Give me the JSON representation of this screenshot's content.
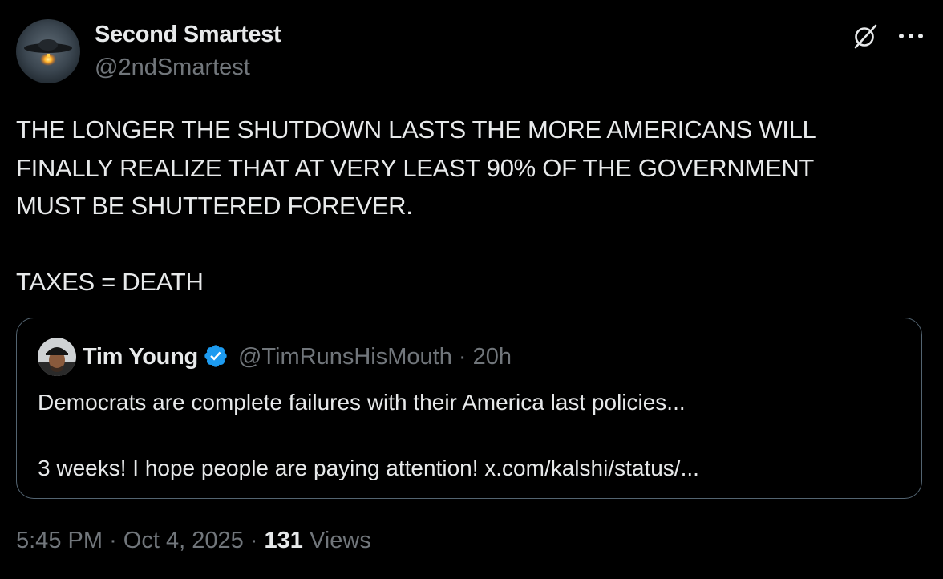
{
  "author": {
    "display_name": "Second Smartest",
    "handle": "@2ndSmartest"
  },
  "icons": {
    "grok": "grok-icon",
    "more": "more-icon",
    "verified": "verified-badge-icon",
    "verified_color": "#1d9bf0"
  },
  "tweet": {
    "lines": [
      "THE LONGER THE SHUTDOWN LASTS THE MORE AMERICANS WILL",
      "FINALLY REALIZE THAT AT VERY LEAST 90% OF THE GOVERNMENT",
      "MUST BE SHUTTERED FOREVER.",
      "TAXES = DEATH"
    ]
  },
  "quoted": {
    "display_name": "Tim Young",
    "handle": "@TimRunsHisMouth",
    "separator": "·",
    "time": "20h",
    "lines": [
      "Democrats are complete failures with their America last policies...",
      "3 weeks!  I hope people are paying attention! x.com/kalshi/status/..."
    ]
  },
  "meta": {
    "time": "5:45 PM",
    "date": "Oct 4, 2025",
    "separator": "·",
    "views_count": "131",
    "views_label": "Views"
  },
  "colors": {
    "background": "#000000",
    "text_primary": "#e7e9ea",
    "text_secondary": "#71767b",
    "border": "#536471"
  }
}
